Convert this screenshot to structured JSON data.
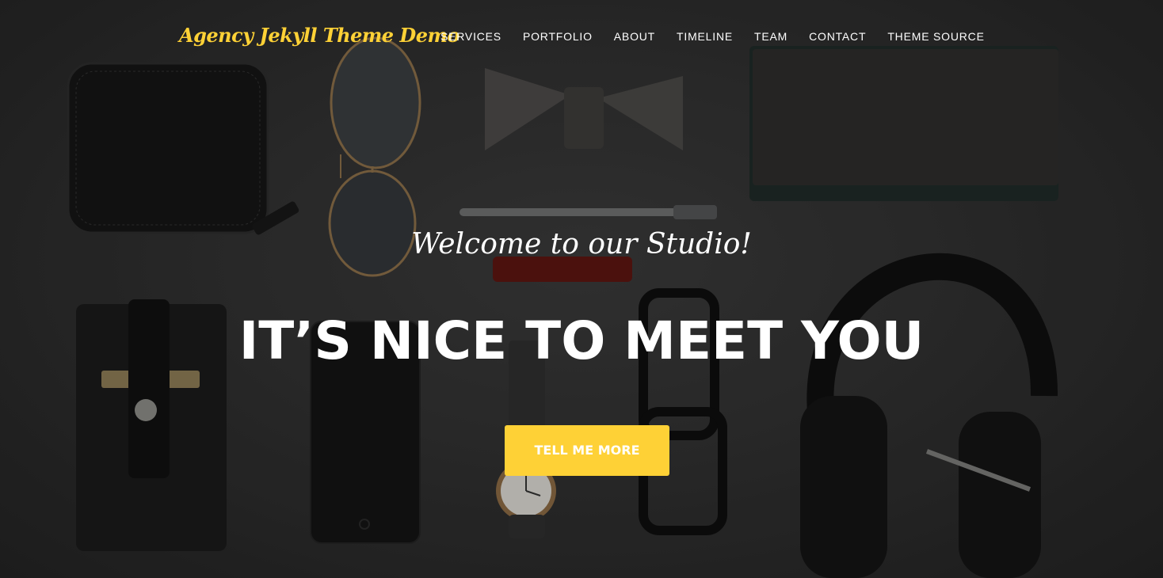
{
  "navbar": {
    "brand": "Agency Jekyll Theme Demo",
    "items": [
      {
        "label": "SERVICES"
      },
      {
        "label": "PORTFOLIO"
      },
      {
        "label": "ABOUT"
      },
      {
        "label": "TIMELINE"
      },
      {
        "label": "TEAM"
      },
      {
        "label": "CONTACT"
      },
      {
        "label": "THEME SOURCE"
      }
    ]
  },
  "hero": {
    "lead": "Welcome to our Studio!",
    "heading": "IT’S NICE TO MEET YOU",
    "button": "TELL ME MORE"
  },
  "colors": {
    "accent": "#fed136",
    "background": "#2b2b2b",
    "text": "#ffffff"
  },
  "icons": [
    "wallet-icon",
    "sunglasses-icon",
    "bow-tie-icon",
    "notebook-icon",
    "pen-icon",
    "lighter-icon",
    "phone-case-icon",
    "smartphone-icon",
    "wristwatch-icon",
    "eyeglasses-icon",
    "headphones-icon"
  ]
}
